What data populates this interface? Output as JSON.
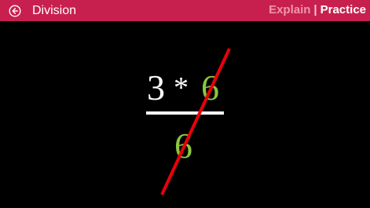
{
  "header": {
    "title": "Division",
    "back_icon": "back-arrow-circle-icon",
    "modes": {
      "explain_label": "Explain",
      "separator": "|",
      "practice_label": "Practice",
      "active": "Practice"
    }
  },
  "problem": {
    "numerator_left": "3",
    "operator": "*",
    "numerator_right": "6",
    "denominator": "6"
  },
  "colors": {
    "header_bg": "#c8204e",
    "background": "#000000",
    "text": "#ffffff",
    "highlight": "#8dc63f",
    "strike": "#e8000b",
    "inactive_mode": "#ee97ad"
  }
}
